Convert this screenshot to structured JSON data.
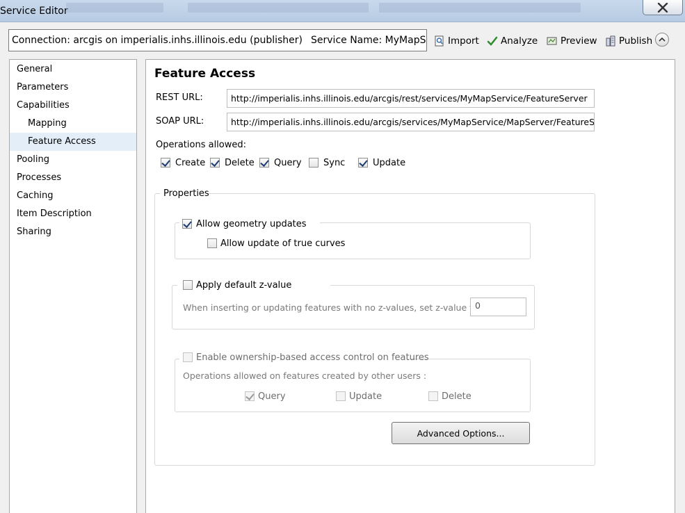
{
  "window": {
    "title": "Service Editor"
  },
  "connection": {
    "text": "Connection: arcgis on imperialis.inhs.illinois.edu (publisher)",
    "service_name": "Service Name: MyMapService"
  },
  "toolbar": {
    "import_label": "Import",
    "analyze_label": "Analyze",
    "preview_label": "Preview",
    "publish_label": "Publish"
  },
  "nav": {
    "items": [
      {
        "label": "General"
      },
      {
        "label": "Parameters"
      },
      {
        "label": "Capabilities"
      },
      {
        "label": "Mapping"
      },
      {
        "label": "Feature Access"
      },
      {
        "label": "Pooling"
      },
      {
        "label": "Processes"
      },
      {
        "label": "Caching"
      },
      {
        "label": "Item Description"
      },
      {
        "label": "Sharing"
      }
    ],
    "selected": "Feature Access"
  },
  "main": {
    "title": "Feature Access",
    "rest_url_label": "REST URL:",
    "rest_url": "http://imperialis.inhs.illinois.edu/arcgis/rest/services/MyMapService/FeatureServer",
    "soap_url_label": "SOAP URL:",
    "soap_url": "http://imperialis.inhs.illinois.edu/arcgis/services/MyMapService/MapServer/FeatureServer",
    "operations_label": "Operations allowed:",
    "operations": [
      {
        "label": "Create",
        "checked": true
      },
      {
        "label": "Delete",
        "checked": true
      },
      {
        "label": "Query",
        "checked": true
      },
      {
        "label": "Sync",
        "checked": false
      },
      {
        "label": "Update",
        "checked": true
      }
    ],
    "properties_label": "Properties",
    "allow_geometry_updates": {
      "label": "Allow geometry updates",
      "checked": true
    },
    "allow_true_curves": {
      "label": "Allow update of true curves",
      "checked": false
    },
    "apply_default_z": {
      "label": "Apply default z-value",
      "checked": false
    },
    "z_help_text": "When inserting or updating features with no z-values, set z-value to:",
    "z_value": "0",
    "ownership": {
      "label": "Enable ownership-based access control on features",
      "checked": false
    },
    "other_users_label": "Operations allowed on features created by other users :",
    "other_users_ops": [
      {
        "label": "Query",
        "checked": true
      },
      {
        "label": "Update",
        "checked": false
      },
      {
        "label": "Delete",
        "checked": false
      }
    ],
    "advanced_button": "Advanced Options..."
  }
}
